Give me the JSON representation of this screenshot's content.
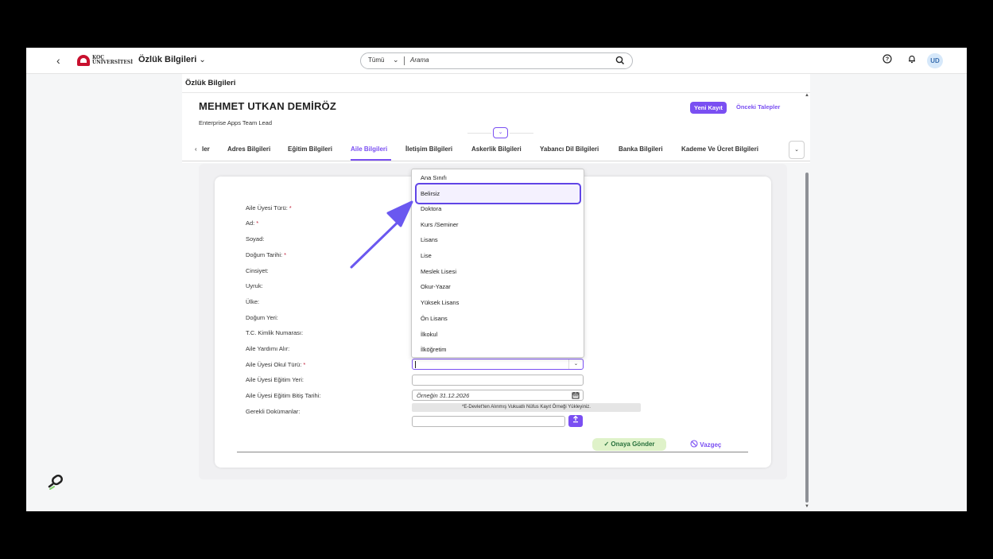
{
  "shell": {
    "app_title": "Özlük Bilgileri",
    "logo_line1": "KOÇ",
    "logo_line2": "ÜNİVERSİTESİ",
    "search_scope": "Tümü",
    "search_placeholder": "Arama",
    "avatar_initials": "UD"
  },
  "page": {
    "title": "Özlük Bilgileri"
  },
  "employee": {
    "name": "MEHMET UTKAN DEMİRÖZ",
    "role": "Enterprise Apps Team Lead",
    "new_record_label": "Yeni Kayıt",
    "previous_requests_label": "Önceki Talepler"
  },
  "tabs": [
    {
      "label": "ler"
    },
    {
      "label": "Adres Bilgileri"
    },
    {
      "label": "Eğitim Bilgileri"
    },
    {
      "label": "Aile Bilgileri",
      "active": true
    },
    {
      "label": "İletişim Bilgileri"
    },
    {
      "label": "Askerlik Bilgileri"
    },
    {
      "label": "Yabancı Dil Bilgileri"
    },
    {
      "label": "Banka Bilgileri"
    },
    {
      "label": "Kademe Ve Ücret Bilgileri"
    }
  ],
  "form": {
    "labels": [
      {
        "text": "Aile Üyesi Türü:",
        "required": "*"
      },
      {
        "text": "Ad:",
        "required": "*"
      },
      {
        "text": "Soyad:",
        "required": ""
      },
      {
        "text": "Doğum Tarihi:",
        "required": "*"
      },
      {
        "text": "Cinsiyet:",
        "required": ""
      },
      {
        "text": "Uyruk:",
        "required": ""
      },
      {
        "text": "Ülke:",
        "required": ""
      },
      {
        "text": "Doğum Yeri:",
        "required": ""
      },
      {
        "text": "T.C. Kimlik Numarası:",
        "required": ""
      },
      {
        "text": "Aile Yardımı Alır:",
        "required": ""
      },
      {
        "text": "Aile Üyesi Okul Türü:",
        "required": "*"
      },
      {
        "text": "Aile Üyesi Eğitim Yeri:",
        "required": ""
      },
      {
        "text": "Aile Üyesi Eğitim Bitiş Tarihi:",
        "required": ""
      },
      {
        "text": "Gerekli Dokümanlar:",
        "required": ""
      }
    ],
    "school_type_value": "",
    "education_place_value": "",
    "end_date_placeholder": "Örneğin 31.12.2026",
    "documents_hint": "*E-Devlet'ten Alınmış Vukuatlı Nüfus Kayıt Örneği Yükleyiniz.",
    "submit_label": "Onaya Gönder",
    "cancel_label": "Vazgeç"
  },
  "dropdown": {
    "options": [
      "Ana Sınıfı",
      "Belirsiz",
      "Doktora",
      "Kurs /Seminer",
      "Lisans",
      "Lise",
      "Meslek Lisesi",
      "Okur-Yazar",
      "Yüksek Lisans",
      "Ön Lisans",
      "İlkokul",
      "İlköğretim"
    ],
    "highlighted": "Belirsiz"
  },
  "colors": {
    "accent": "#7a4ff2",
    "annotation": "#6045e6",
    "submit_bg": "#dff2c9",
    "required": "#c0233c"
  },
  "icons": [
    "back-icon",
    "chevron-down-icon",
    "search-icon",
    "help-icon",
    "bell-icon",
    "calendar-icon",
    "upload-icon",
    "check-icon",
    "cancel-circle-icon",
    "link-icon"
  ]
}
